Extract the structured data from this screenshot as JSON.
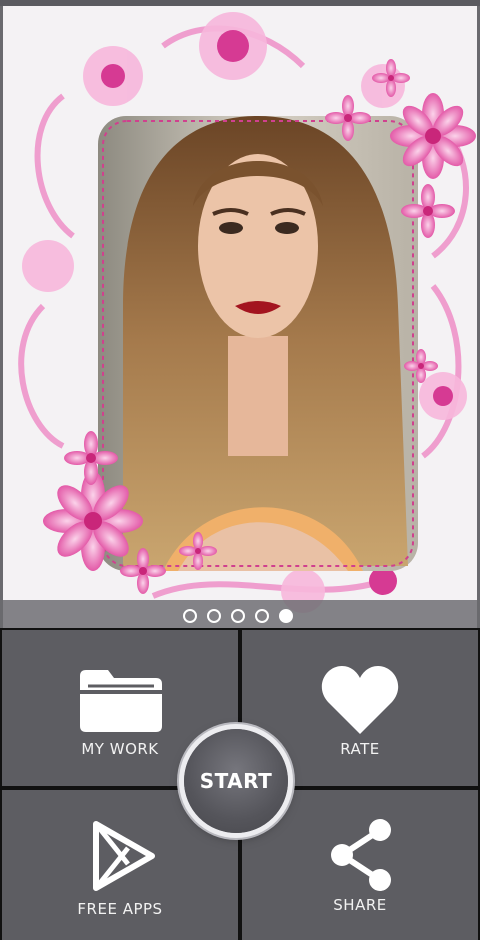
{
  "preview": {
    "image_desc": "portrait-photo-in-pink-floral-frame",
    "pager_count": 5,
    "pager_active_index": 4
  },
  "menu": {
    "my_work_label": "MY WORK",
    "rate_label": "RATE",
    "free_apps_label": "FREE APPS",
    "share_label": "SHARE",
    "start_label": "START"
  },
  "colors": {
    "panel": "#5d5d62",
    "frame_pink": "#e0509f",
    "frame_light": "#f4a6d2"
  }
}
